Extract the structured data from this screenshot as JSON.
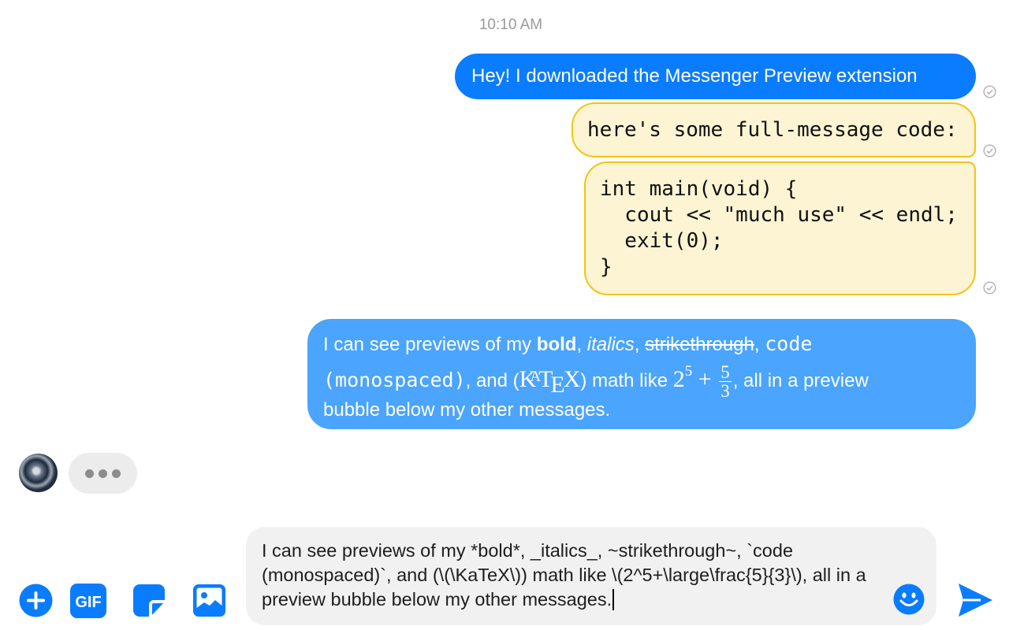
{
  "thread": {
    "timestamp": "10:10 AM",
    "messages": {
      "greeting": "Hey! I downloaded the Messenger Preview extension",
      "code_inline": "here's some full-message code:",
      "code_block": "int main(void) {\n  cout << \"much use\" << endl;\n  exit(0);\n}"
    },
    "preview": {
      "l1_a": "I can see previews of my ",
      "bold": "bold",
      "comma1": ", ",
      "italic": "italics",
      "comma2": ", ",
      "strike": "strikethrough",
      "comma3": ", ",
      "code_a": "code",
      "code_b": "(monospaced)",
      "and_open": ", and (",
      "katex_k": "K",
      "katex_a": "A",
      "katex_t": "T",
      "katex_e": "E",
      "katex_x": "X",
      "math_like": ") math like ",
      "base": "2",
      "exp": "5",
      "plus": "+",
      "num": "5",
      "den": "3",
      "tail": ", all in a preview",
      "l3": "bubble below my other messages."
    }
  },
  "typing_indicator": {
    "avatar": "contact-avatar"
  },
  "composer": {
    "text": "I can see previews of my *bold*, _italics_, ~strikethrough~, `code (monospaced)`, and (\\(\\KaTeX\\)) math like \\(2^5+\\large\\frac{5}{3}\\), all in a preview bubble below my other messages."
  },
  "toolbar": {
    "icons": [
      "plus-icon",
      "gif-icon",
      "sticker-icon",
      "photo-icon",
      "emoji-icon",
      "send-icon"
    ],
    "gif_label": "GIF"
  },
  "colors": {
    "blue_bubble": "#0a7cff",
    "preview_bubble": "#4ba4fd",
    "code_bubble_bg": "#fdf4d3",
    "code_bubble_border": "#f2c417",
    "icon_blue": "#0a7cff"
  }
}
